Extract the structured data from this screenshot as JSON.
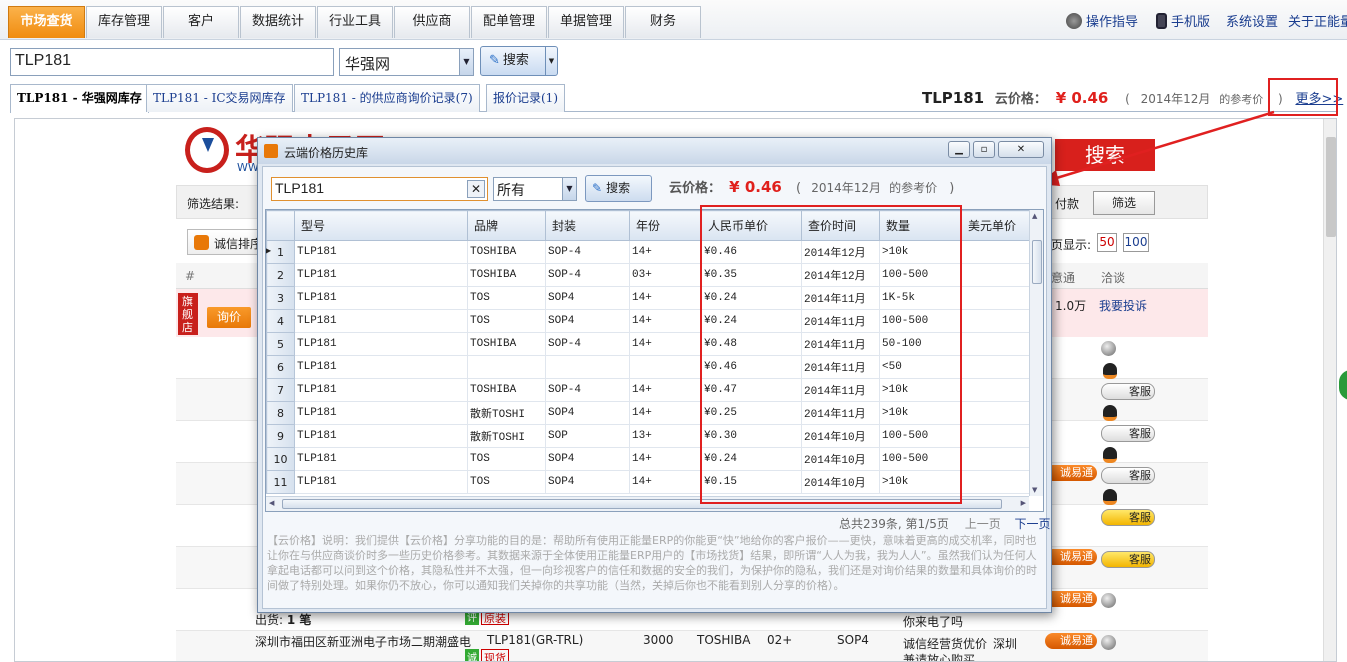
{
  "nav": {
    "tabs": [
      "市场查货",
      "库存管理",
      "客户",
      "数据统计",
      "行业工具",
      "供应商",
      "配单管理",
      "单据管理",
      "财务"
    ],
    "links": [
      "操作指导",
      "手机版",
      "系统设置",
      "关于正能量"
    ]
  },
  "search": {
    "value": "TLP181",
    "site": "华强网",
    "button": "搜索"
  },
  "subtabs": [
    "TLP181 - 华强网库存",
    "TLP181 - IC交易网库存",
    "TLP181 - 的供应商询价记录(7)",
    "报价记录(1)"
  ],
  "cloud_price": {
    "part": "TLP181",
    "label": "云价格：",
    "value": "¥ 0.46",
    "paren_open": "(",
    "date": "2014年12月",
    "suffix": "的参考价",
    "paren_close": ")",
    "more": "更多>>"
  },
  "background": {
    "brand": "华强电子网",
    "brand_sub": "WW",
    "big_search": "搜索",
    "filter_label": "筛选结果:",
    "filter_right": "付款",
    "filter_btn": "筛选",
    "chengxin": "诚信排序",
    "show_label": "页显示:",
    "show_50": "50",
    "show_100": "100",
    "hash": "#",
    "col_yt": "意通",
    "col_qt": "洽谈",
    "flagship": "旗舰店",
    "money": "1.0万",
    "complain": "我要投诉",
    "inquiry": "询价",
    "kefu": "客服",
    "cyt": "诚易通",
    "chuhuo": "出货:",
    "chuhuo_n": "1 笔",
    "note1": "你来电了吗",
    "company": "深圳市福田区新亚洲电子市场二期潮盛电",
    "model": "TLP181(GR-TRL)",
    "qty": "3000",
    "brand_t": "TOSHIBA",
    "year": "02+",
    "pkg": "SOP4",
    "promise": "诚信经营货优价",
    "city": "深圳",
    "note2": "兼请放心购买",
    "tag_ping": "评",
    "tag_yuanzhuang": "原装",
    "tag_cheng": "诚",
    "tag_xianhuo": "现货"
  },
  "modal": {
    "title": "云端价格历史库",
    "search_value": "TLP181",
    "filter": "所有",
    "button": "搜索",
    "price_label": "云价格：",
    "price": "¥ 0.46",
    "paren_open": "(",
    "price_date": "2014年12月",
    "price_suffix": "的参考价",
    "paren_close": ")",
    "columns": [
      "型号",
      "品牌",
      "封装",
      "年份",
      "人民币单价",
      "查价时间",
      "数量",
      "美元单价"
    ],
    "rows": [
      [
        "1",
        "TLP181",
        "TOSHIBA",
        "SOP-4",
        "14+",
        "¥0.46",
        "2014年12月",
        ">10k",
        ""
      ],
      [
        "2",
        "TLP181",
        "TOSHIBA",
        "SOP-4",
        "03+",
        "¥0.35",
        "2014年12月",
        "100-500",
        ""
      ],
      [
        "3",
        "TLP181",
        "TOS",
        "SOP4",
        "14+",
        "¥0.24",
        "2014年11月",
        "1K-5k",
        ""
      ],
      [
        "4",
        "TLP181",
        "TOS",
        "SOP4",
        "14+",
        "¥0.24",
        "2014年11月",
        "100-500",
        ""
      ],
      [
        "5",
        "TLP181",
        "TOSHIBA",
        "SOP-4",
        "14+",
        "¥0.48",
        "2014年11月",
        "50-100",
        ""
      ],
      [
        "6",
        "TLP181",
        "",
        "",
        "",
        "¥0.46",
        "2014年11月",
        "<50",
        ""
      ],
      [
        "7",
        "TLP181",
        "TOSHIBA",
        "SOP-4",
        "14+",
        "¥0.47",
        "2014年11月",
        ">10k",
        ""
      ],
      [
        "8",
        "TLP181",
        "散新TOSHI",
        "SOP4",
        "14+",
        "¥0.25",
        "2014年11月",
        ">10k",
        ""
      ],
      [
        "9",
        "TLP181",
        "散新TOSHI",
        "SOP",
        "13+",
        "¥0.30",
        "2014年10月",
        "100-500",
        ""
      ],
      [
        "10",
        "TLP181",
        "TOS",
        "SOP4",
        "14+",
        "¥0.24",
        "2014年10月",
        "100-500",
        ""
      ],
      [
        "11",
        "TLP181",
        "TOS",
        "SOP4",
        "14+",
        "¥0.15",
        "2014年10月",
        ">10k",
        ""
      ]
    ],
    "pager_info": "总共239条, 第1/5页",
    "prev": "上一页",
    "next": "下一页",
    "description": "【云价格】说明：我们提供【云价格】分享功能的目的是：帮助所有使用正能量ERP的你能更“快”地给你的客户报价——更快，意味着更高的成交机率，同时也让你在与供应商谈价时多一些历史价格参考。其数据来源于全体使用正能量ERP用户的【市场找货】结果，即所谓“人人为我，我为人人”。虽然我们认为任何人拿起电话都可以问到这个价格，其隐私性并不太强，但一向珍视客户的信任和数据的安全的我们，为保护你的隐私，我们还是对询价结果的数量和具体询价的时间做了特别处理。如果你仍不放心，你可以通知我们关掉你的共享功能（当然，关掉后你也不能看到别人分享的价格）。"
  },
  "colors": {
    "accent": "#f08c10",
    "price_red": "#e0201c",
    "link_blue": "#1a3d8f",
    "highlight": "#e02020"
  }
}
